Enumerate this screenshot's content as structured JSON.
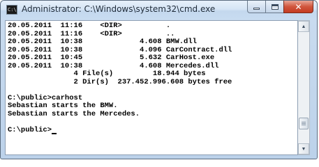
{
  "window": {
    "title": "Administrator: C:\\Windows\\system32\\cmd.exe",
    "icon_name": "cmd-console-icon",
    "icon_glyph": "C:\\",
    "close_glyph": "✕"
  },
  "console": {
    "lines": [
      "20.05.2011  11:16    <DIR>          .",
      "20.05.2011  11:16    <DIR>          ..",
      "20.05.2011  10:38             4.608 BMW.dll",
      "20.05.2011  10:38             4.096 CarContract.dll",
      "20.05.2011  10:45             5.632 CarHost.exe",
      "20.05.2011  10:38             4.608 Mercedes.dll",
      "               4 File(s)         18.944 bytes",
      "               2 Dir(s)  237.452.996.608 bytes free",
      "",
      "C:\\public>carhost",
      "Sebastian starts the BMW.",
      "Sebastian starts the Mercedes.",
      "",
      "C:\\public>"
    ]
  },
  "scrollbar": {
    "up_glyph": "▲",
    "down_glyph": "▼"
  }
}
